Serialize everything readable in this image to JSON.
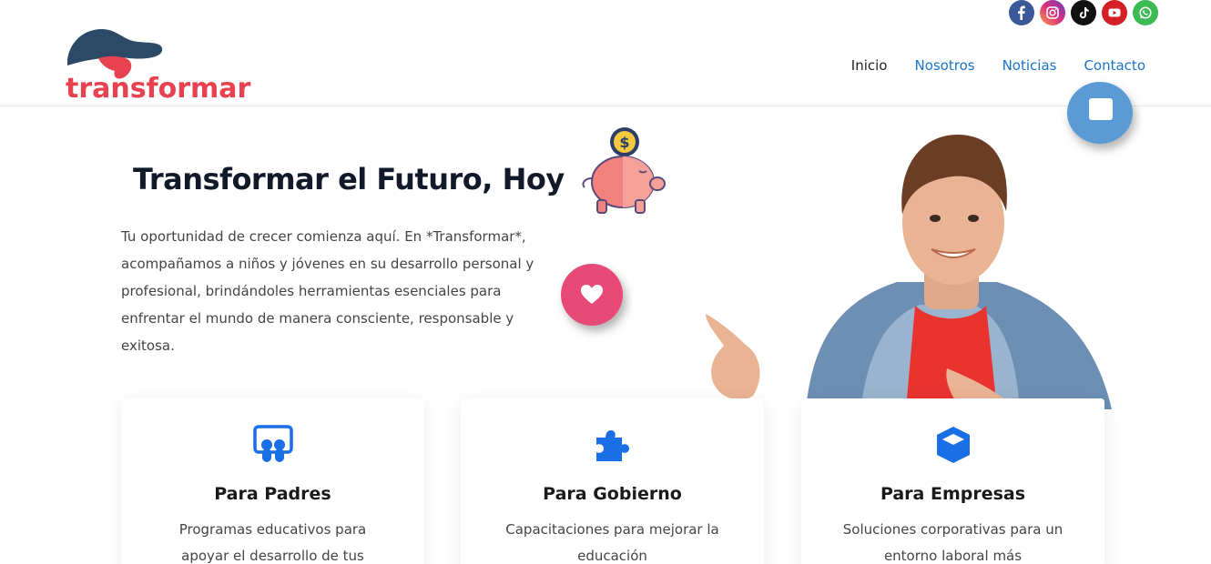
{
  "brand": {
    "name": "transformar",
    "colors": {
      "primary_red": "#e8414f",
      "dark_blue": "#2c4a66",
      "link_blue": "#1a73c4"
    }
  },
  "social": [
    {
      "name": "facebook-icon",
      "color": "#3b5998"
    },
    {
      "name": "instagram-icon",
      "color": "#d92e7f"
    },
    {
      "name": "tiktok-icon",
      "color": "#111111"
    },
    {
      "name": "youtube-icon",
      "color": "#d41f26"
    },
    {
      "name": "whatsapp-icon",
      "color": "#3cba54"
    }
  ],
  "nav": {
    "items": [
      {
        "label": "Inicio",
        "active": true
      },
      {
        "label": "Nosotros",
        "active": false
      },
      {
        "label": "Noticias",
        "active": false
      },
      {
        "label": "Contacto",
        "active": false
      }
    ]
  },
  "hero": {
    "title": "Transformar el Futuro, Hoy",
    "text": "Tu oportunidad de crecer comienza aquí. En *Transformar*, acompañamos a niños y jóvenes en su desarrollo personal y profesional, brindándoles herramientas esenciales para enfrentar el mundo de manera consciente, responsable y exitosa."
  },
  "cards": [
    {
      "icon": "slideshare-icon",
      "title": "Para Padres",
      "text": "Programas educativos para apoyar el desarrollo de tus"
    },
    {
      "icon": "puzzle-piece-icon",
      "title": "Para Gobierno",
      "text": "Capacitaciones para mejorar la educación"
    },
    {
      "icon": "cube-icon",
      "title": "Para Empresas",
      "text": "Soluciones corporativas para un entorno laboral más"
    }
  ]
}
